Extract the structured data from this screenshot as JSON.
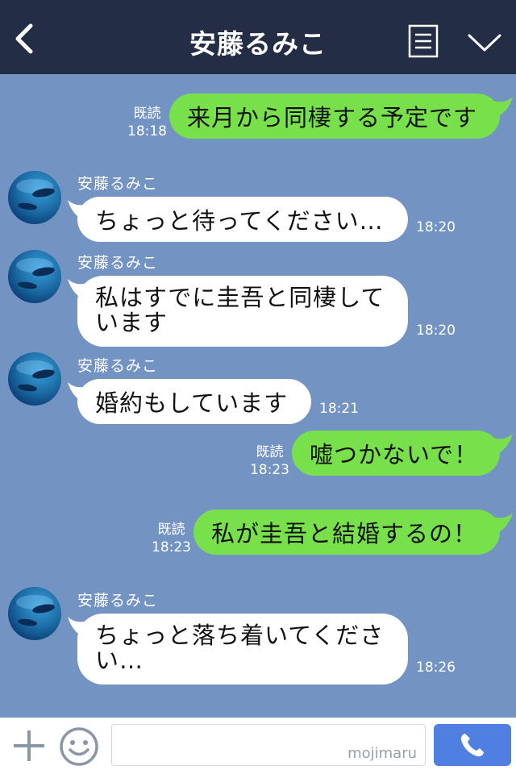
{
  "header": {
    "title": "安藤るみこ"
  },
  "messages": [
    {
      "side": "me",
      "text": "来月から同棲する予定です",
      "read": "既読",
      "time": "18:18"
    },
    {
      "side": "them",
      "sender": "安藤るみこ",
      "text": "ちょっと待ってください…",
      "time": "18:20"
    },
    {
      "side": "them",
      "sender": "安藤るみこ",
      "text_line1": "私はすでに圭吾と同棲して",
      "text_line2": "います",
      "time": "18:20"
    },
    {
      "side": "them",
      "sender": "安藤るみこ",
      "text": "婚約もしています",
      "time": "18:21"
    },
    {
      "side": "me",
      "text": "嘘つかないで！",
      "read": "既読",
      "time": "18:23"
    },
    {
      "side": "me",
      "text": "私が圭吾と結婚するの！",
      "read": "既読",
      "time": "18:23"
    },
    {
      "side": "them",
      "sender": "安藤るみこ",
      "text_line1": "ちょっと落ち着いてくださ",
      "text_line2": "い…",
      "time": "18:26"
    }
  ],
  "footer": {
    "watermark": "mojimaru"
  },
  "colors": {
    "header_bg": "#232d45",
    "chat_bg": "#7394c3",
    "my_bubble": "#77e04a",
    "their_bubble": "#ffffff",
    "call_button": "#4f7fe0"
  },
  "icons": [
    "back-arrow-icon",
    "menu-icon",
    "chevron-down-icon",
    "avatar",
    "plus-icon",
    "smile-icon",
    "phone-icon"
  ]
}
